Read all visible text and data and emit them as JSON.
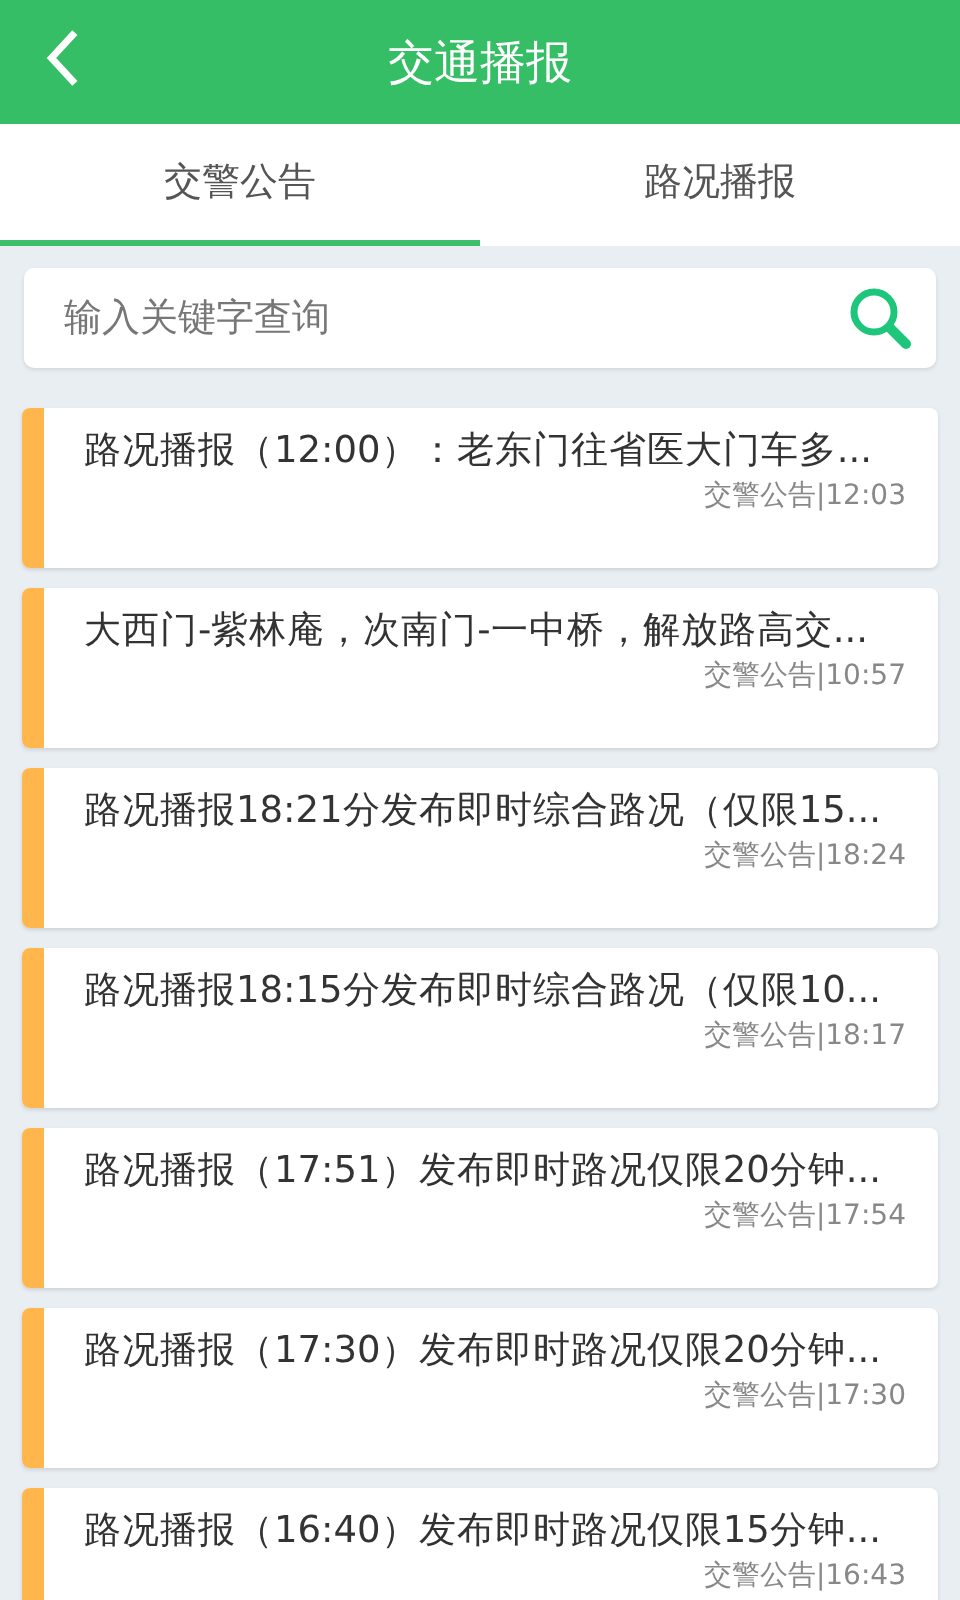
{
  "header": {
    "title": "交通播报"
  },
  "tabs": [
    {
      "label": "交警公告",
      "selected": true
    },
    {
      "label": "路况播报",
      "selected": false
    }
  ],
  "search": {
    "placeholder": "输入关键字查询"
  },
  "items": [
    {
      "title": "路况播报（12:00）：老东门往省医大门车多...",
      "meta": "交警公告|12:03"
    },
    {
      "title": "大西门-紫林庵，次南门-一中桥，解放路高交...",
      "meta": "交警公告|10:57"
    },
    {
      "title": "路况播报18:21分发布即时综合路况（仅限15...",
      "meta": "交警公告|18:24"
    },
    {
      "title": "路况播报18:15分发布即时综合路况（仅限10...",
      "meta": "交警公告|18:17"
    },
    {
      "title": "路况播报（17:51）发布即时路况仅限20分钟...",
      "meta": "交警公告|17:54"
    },
    {
      "title": "路况播报（17:30）发布即时路况仅限20分钟...",
      "meta": "交警公告|17:30"
    },
    {
      "title": "路况播报（16:40）发布即时路况仅限15分钟...",
      "meta": "交警公告|16:43"
    }
  ]
}
